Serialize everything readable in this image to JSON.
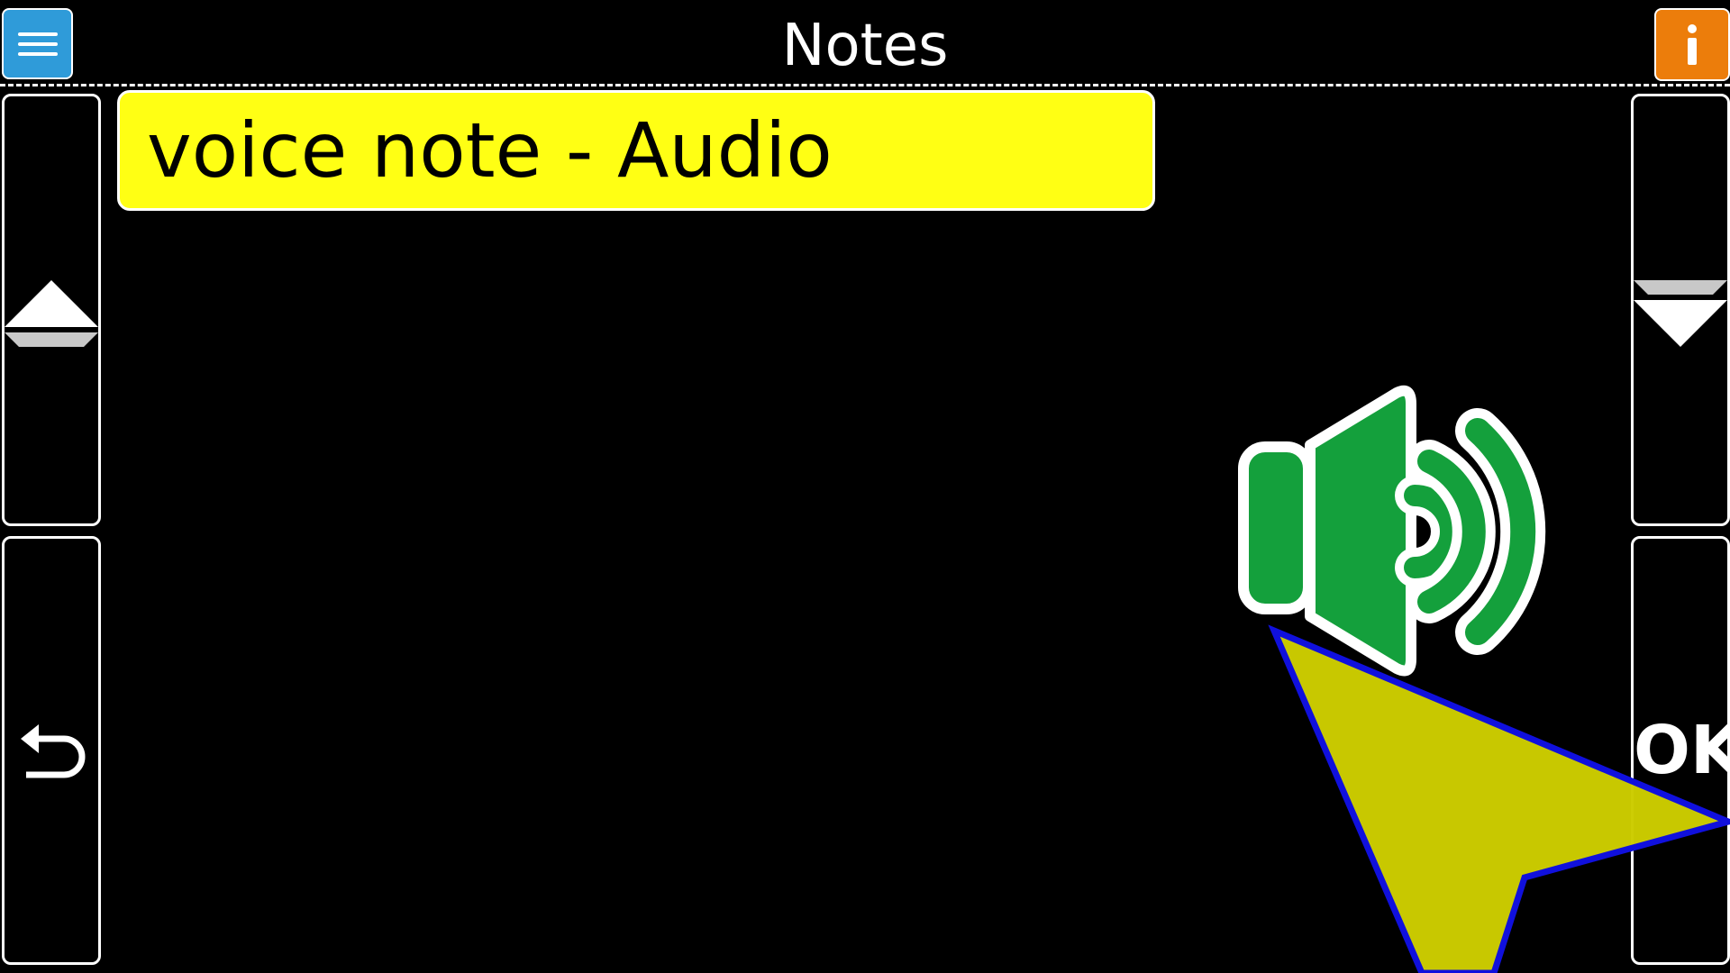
{
  "header": {
    "title": "Notes",
    "menu_icon": "hamburger-menu-icon",
    "info_icon": "info-icon",
    "colors": {
      "menu_button": "#2f9bd9",
      "info_button": "#ec7d0b"
    }
  },
  "left_panel": {
    "scroll_up_icon": "scroll-up-arrow-icon",
    "back_icon": "back-arrow-icon"
  },
  "right_panel": {
    "scroll_down_icon": "scroll-down-arrow-icon",
    "ok_label": "OK"
  },
  "notes_list": {
    "items": [
      {
        "label": "voice note - Audio",
        "highlighted": true
      }
    ],
    "highlight_color": "#ffff14"
  },
  "preview": {
    "icon": "speaker-icon",
    "color": "#14a03c"
  },
  "cursor": {
    "icon": "pointer-cursor-icon",
    "fill": "#cccc00",
    "outline": "#1010dd"
  }
}
